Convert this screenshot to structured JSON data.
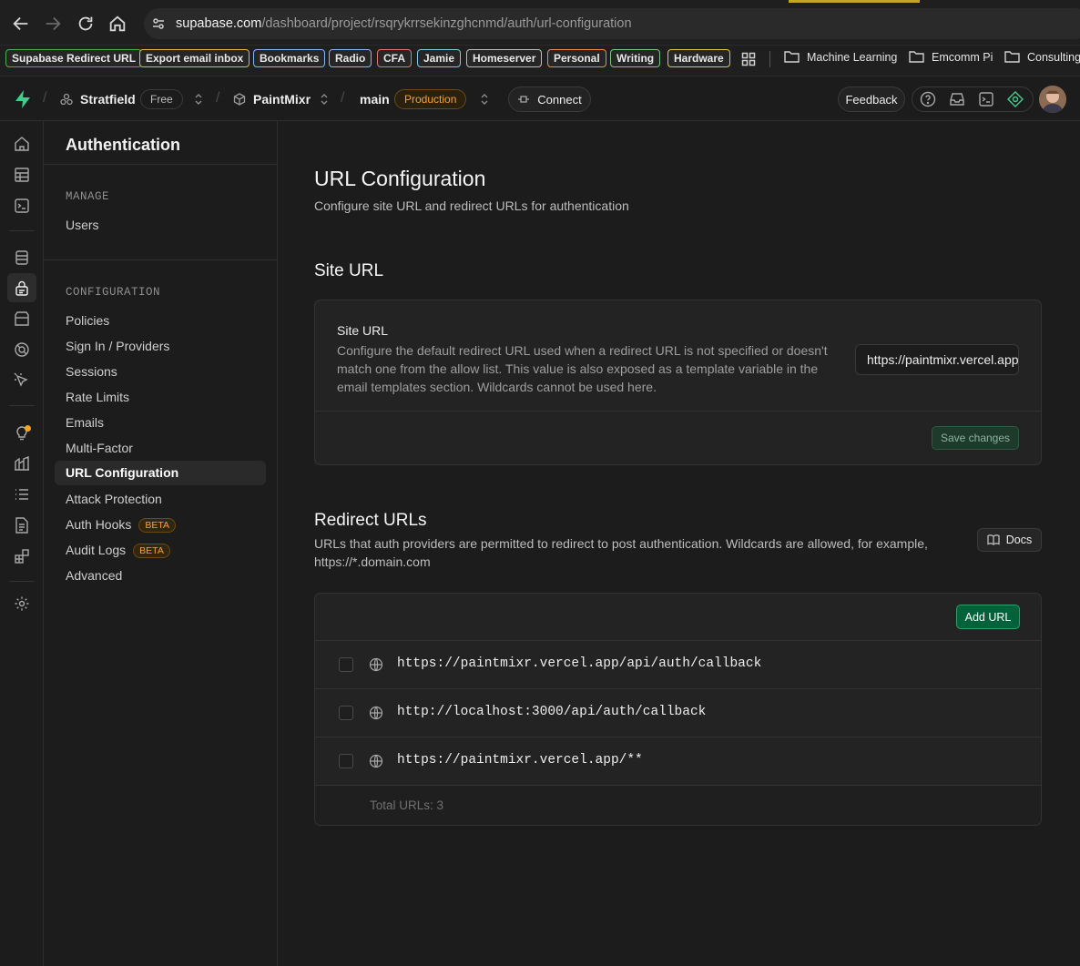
{
  "browser": {
    "url_host": "supabase.com",
    "url_path": "/dashboard/project/rsqrykrrsekinzghcnmd/auth/url-configuration"
  },
  "bookmarks": {
    "tags": [
      {
        "label": "Supabase Redirect URL",
        "color": "#4caf50"
      },
      {
        "label": "Export email inbox",
        "color": "#e0b93a"
      },
      {
        "label": "Bookmarks",
        "color": "#8ab4f8"
      },
      {
        "label": "Radio",
        "color": "#8ab4f8"
      },
      {
        "label": "CFA",
        "color": "#e57373"
      },
      {
        "label": "Jamie",
        "color": "#7fc8e0"
      },
      {
        "label": "Homeserver",
        "color": "#bdbdbd"
      },
      {
        "label": "Personal",
        "color": "#f08a4b"
      },
      {
        "label": "Writing",
        "color": "#7cc47f"
      },
      {
        "label": "Hardware",
        "color": "#e0c83a"
      }
    ],
    "folders": [
      "Machine Learning",
      "Emcomm Pi",
      "Consulting"
    ]
  },
  "header": {
    "org": "Stratfield",
    "plan": "Free",
    "project": "PaintMixr",
    "branch": "main",
    "env": "Production",
    "connect": "Connect",
    "feedback": "Feedback"
  },
  "sidebar": {
    "title": "Authentication",
    "manage_heading": "MANAGE",
    "manage_items": [
      "Users"
    ],
    "config_heading": "CONFIGURATION",
    "config_items": [
      "Policies",
      "Sign In / Providers",
      "Sessions",
      "Rate Limits",
      "Emails",
      "Multi-Factor",
      "URL Configuration",
      "Attack Protection",
      "Auth Hooks",
      "Audit Logs",
      "Advanced"
    ],
    "beta_label": "BETA",
    "active": "URL Configuration"
  },
  "main": {
    "title": "URL Configuration",
    "subtitle": "Configure site URL and redirect URLs for authentication",
    "site_url_heading": "Site URL",
    "site_url_label": "Site URL",
    "site_url_description": "Configure the default redirect URL used when a redirect URL is not specified or doesn't match one from the allow list. This value is also exposed as a template variable in the email templates section. Wildcards cannot be used here.",
    "site_url_value": "https://paintmixr.vercel.app",
    "save_label": "Save changes",
    "redirect_heading": "Redirect URLs",
    "redirect_description": "URLs that auth providers are permitted to redirect to post authentication. Wildcards are allowed, for example, https://*.domain.com",
    "docs_label": "Docs",
    "add_url_label": "Add URL",
    "redirect_urls": [
      "https://paintmixr.vercel.app/api/auth/callback",
      "http://localhost:3000/api/auth/callback",
      "https://paintmixr.vercel.app/**"
    ],
    "total_label": "Total URLs: 3"
  }
}
